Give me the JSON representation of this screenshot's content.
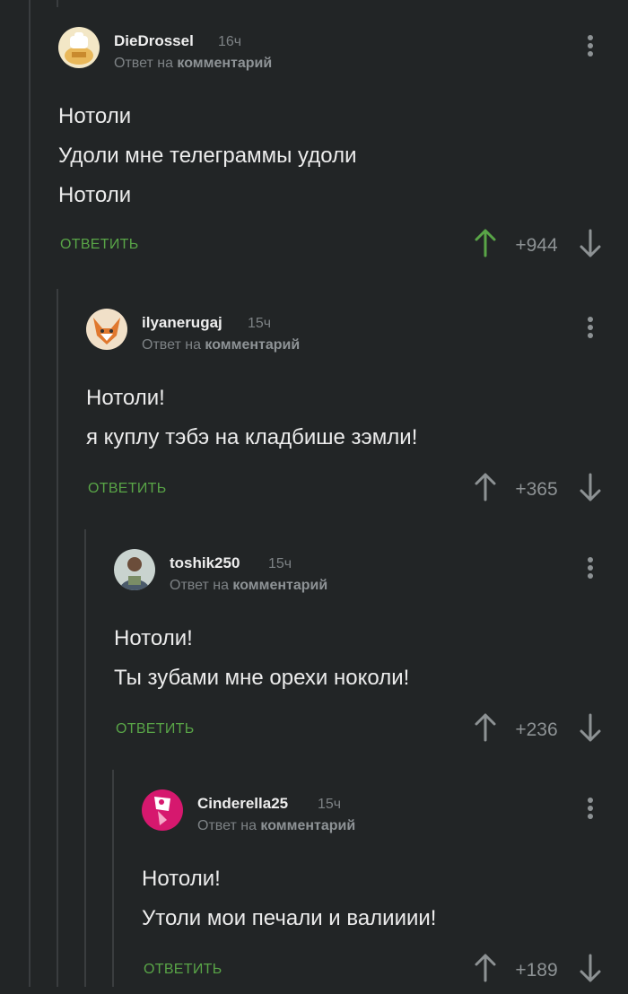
{
  "comments": [
    {
      "username": "DieDrossel",
      "time": "16ч",
      "reply_prefix": "Ответ на",
      "reply_target": "комментарий",
      "lines": [
        "Нотоли",
        "Удоли мне телеграммы удоли",
        "Нотоли"
      ],
      "reply_label": "ОТВЕТИТЬ",
      "score": "+944",
      "upvoted": true
    },
    {
      "username": "ilyanerugaj",
      "time": "15ч",
      "reply_prefix": "Ответ на",
      "reply_target": "комментарий",
      "lines": [
        "Нотоли!",
        "я куплу тэбэ на кладбише зэмли!"
      ],
      "reply_label": "ОТВЕТИТЬ",
      "score": "+365",
      "upvoted": false
    },
    {
      "username": "toshik250",
      "time": "15ч",
      "reply_prefix": "Ответ на",
      "reply_target": "комментарий",
      "lines": [
        "Нотоли!",
        "Ты зубами мне орехи ноколи!"
      ],
      "reply_label": "ОТВЕТИТЬ",
      "score": "+236",
      "upvoted": false
    },
    {
      "username": "Cinderella25",
      "time": "15ч",
      "reply_prefix": "Ответ на",
      "reply_target": "комментарий",
      "lines": [
        "Нотоли!",
        "Утоли мои печали и валииии!"
      ],
      "reply_label": "ОТВЕТИТЬ",
      "score": "+189",
      "upvoted": false
    }
  ],
  "colors": {
    "background": "#222526",
    "accent_green": "#59a547",
    "muted": "#7d8285",
    "thread_line": "#3a3d3f"
  },
  "icons": {
    "menu": "three-dots-vertical-icon",
    "upvote": "arrow-up-icon",
    "downvote": "arrow-down-icon"
  }
}
